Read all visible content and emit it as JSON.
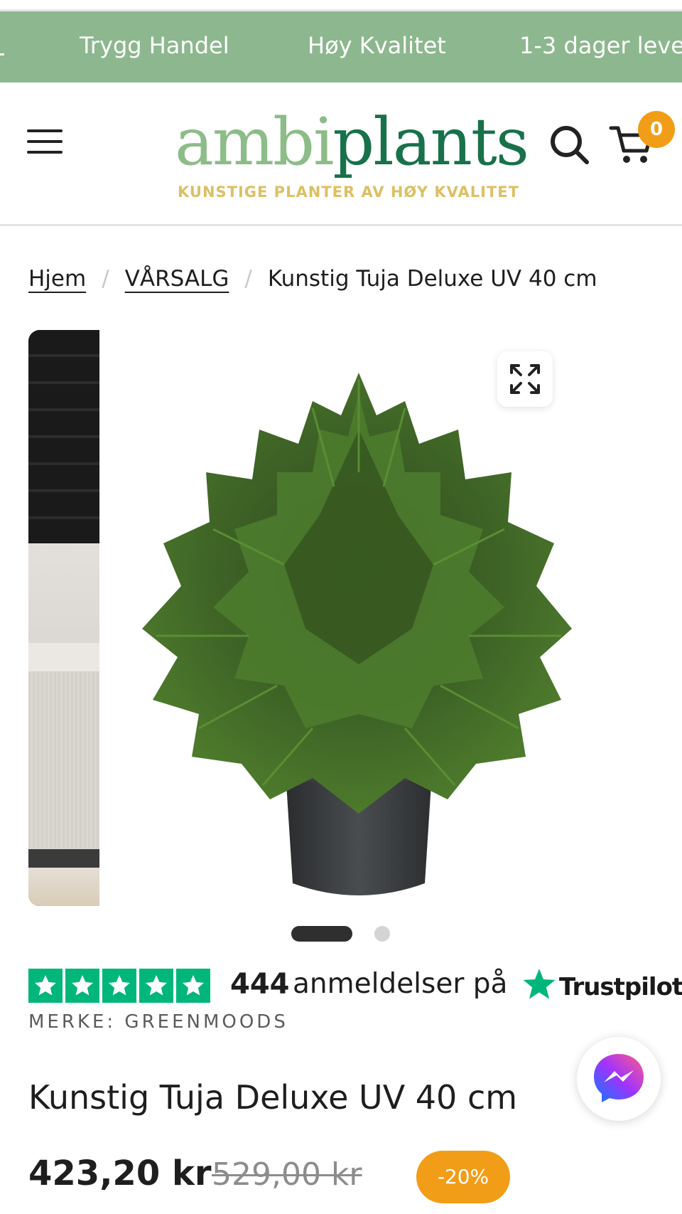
{
  "announcement_bar": {
    "items": [
      "Trygg Handel",
      "Høy Kvalitet",
      "1-3 dager leve"
    ]
  },
  "header": {
    "logo": {
      "word_part1": "ambi",
      "word_part2": "plants",
      "tagline": "KUNSTIGE PLANTER AV HØY KVALITET"
    },
    "cart_count": "0"
  },
  "breadcrumb": {
    "items": [
      "Hjem",
      "VÅRSALG",
      "Kunstig Tuja Deluxe UV 40 cm"
    ],
    "separator": "/"
  },
  "gallery": {
    "slide_count": 2,
    "active_slide": 1
  },
  "trustpilot": {
    "rating_stars": 5,
    "review_count": "444",
    "review_text": "anmeldelser på",
    "brand_name": "Trustpilot"
  },
  "product": {
    "brand_line": "MERKE: GREENMOODS",
    "title": "Kunstig Tuja Deluxe UV 40 cm",
    "price": "423,20 kr",
    "original_price": "529,00 kr",
    "discount": "-20%"
  },
  "icons": {
    "menu": "hamburger-menu-icon",
    "search": "search-icon",
    "cart": "shopping-cart-icon",
    "expand": "expand-icon",
    "chat": "messenger-icon"
  },
  "colors": {
    "announcement_bg": "#8db78e",
    "brand_light_green": "#8cbc88",
    "brand_dark_green": "#18714a",
    "tagline_gold": "#dcc064",
    "accent_orange": "#f29d17",
    "trustpilot_green": "#00b67a"
  }
}
